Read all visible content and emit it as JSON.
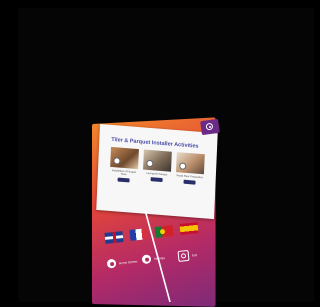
{
  "panel": {
    "title": "Tiler & Parquet Installer Activities",
    "activities": [
      {
        "label": "Installation of Parquet Floor"
      },
      {
        "label": "Laying the Parquet"
      },
      {
        "label": "Wood Floor Preparation"
      }
    ]
  },
  "languages": [
    {
      "name": "English",
      "icon": "flag-uk-icon"
    },
    {
      "name": "French",
      "icon": "flag-france-icon"
    },
    {
      "name": "Portuguese",
      "icon": "flag-portugal-icon"
    },
    {
      "name": "Spanish",
      "icon": "flag-spain-icon"
    }
  ],
  "bottom_menu": [
    {
      "label": "Home Screen",
      "icon": "home-circle-icon"
    },
    {
      "label": "Settings",
      "icon": "settings-circle-icon"
    },
    {
      "label": "Exit",
      "icon": "exit-icon"
    }
  ],
  "colors": {
    "gradient_top": "#f2862a",
    "gradient_mid": "#e2453a",
    "gradient_bottom": "#7e2a78",
    "title_color": "#4a4ca8",
    "close_button": "#6a2b86",
    "button_dark": "#2a2f6a"
  }
}
